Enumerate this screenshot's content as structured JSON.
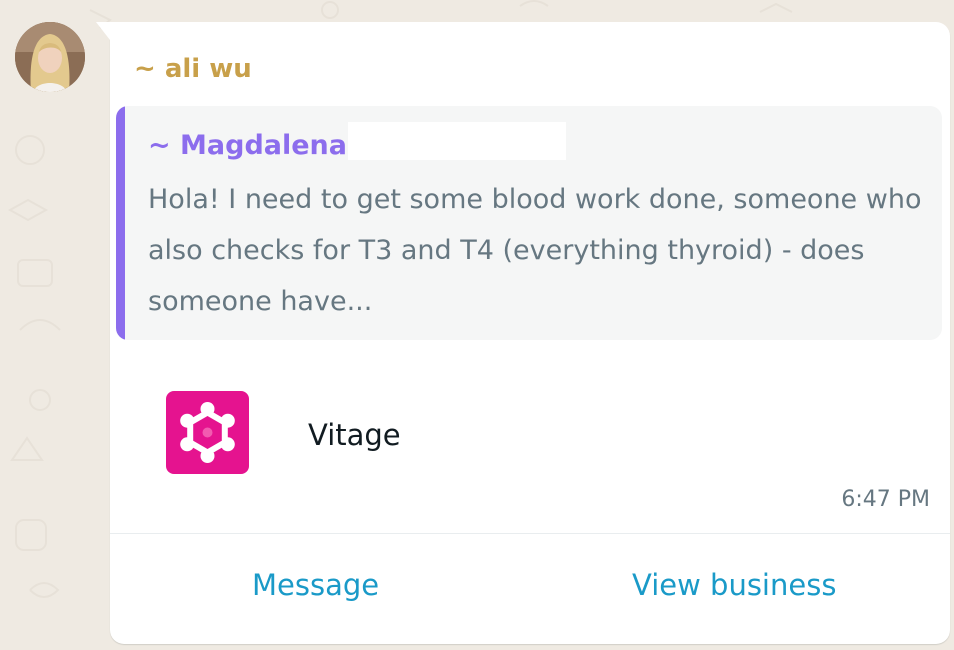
{
  "sender": {
    "name": "~ ali wu",
    "name_color": "#c8a04a"
  },
  "quoted_message": {
    "author": "~ Magdalena",
    "author_color": "#8c6ded",
    "text": "Hola! I need to get some blood work done, someone who also checks for T3 and T4 (everything thyroid) - does someone have..."
  },
  "business_card": {
    "name": "Vitage",
    "logo_icon": "vitage-logo-icon",
    "logo_color": "#e5138f"
  },
  "message": {
    "time": "6:47 PM"
  },
  "actions": {
    "message_label": "Message",
    "view_business_label": "View business",
    "accent_color": "#1a9ac8"
  },
  "theme": {
    "chat_background": "#efeae2",
    "bubble_background": "#ffffff",
    "quote_background": "#f5f6f6"
  }
}
